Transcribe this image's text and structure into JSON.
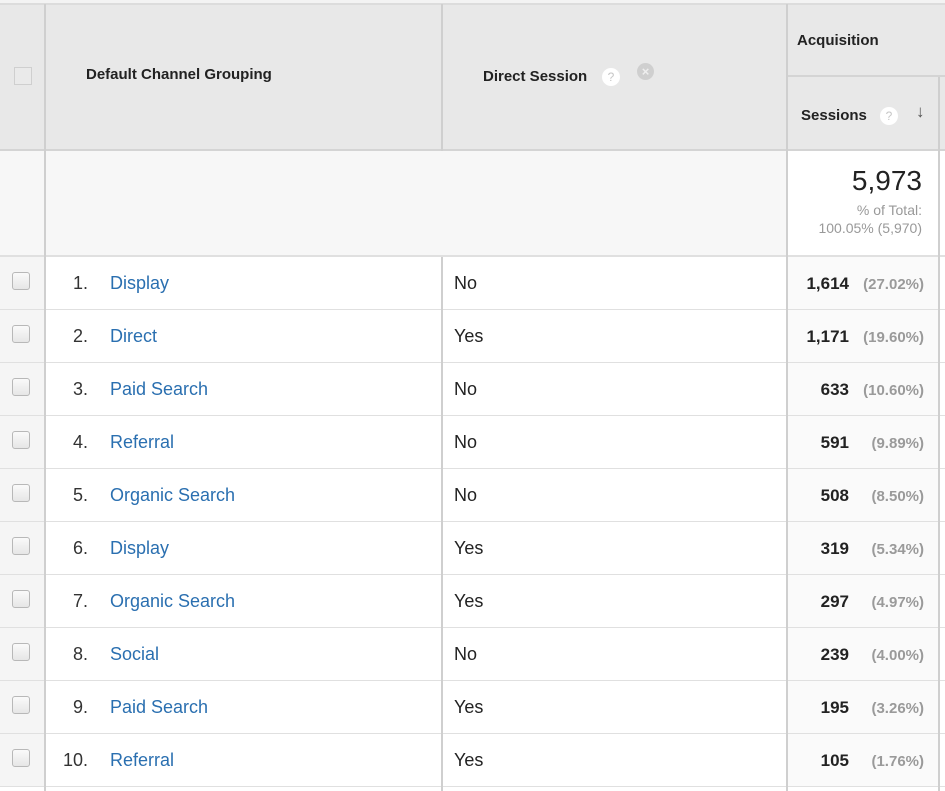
{
  "header": {
    "dimension_label": "Default Channel Grouping",
    "secondary_dimension_label": "Direct Session",
    "group_label": "Acquisition",
    "metric_label": "Sessions",
    "help_glyph": "?",
    "remove_glyph": "×",
    "sort_glyph": "↓"
  },
  "icons": {
    "help": "help-icon",
    "remove": "remove-dimension-icon",
    "sort": "sort-descending-arrow-icon",
    "checkbox": "checkbox"
  },
  "totals": {
    "sessions": "5,973",
    "pct_of_total_label": "% of Total:",
    "pct_of_total_value": "100.05% (5,970)"
  },
  "colors": {
    "link": "#2a6fb0",
    "header_bg": "#e8e8e8",
    "muted_text": "#9a9a9a"
  },
  "rows": [
    {
      "index": "1.",
      "channel": "Display",
      "direct": "No",
      "sessions": "1,614",
      "pct": "(27.02%)"
    },
    {
      "index": "2.",
      "channel": "Direct",
      "direct": "Yes",
      "sessions": "1,171",
      "pct": "(19.60%)"
    },
    {
      "index": "3.",
      "channel": "Paid Search",
      "direct": "No",
      "sessions": "633",
      "pct": "(10.60%)"
    },
    {
      "index": "4.",
      "channel": "Referral",
      "direct": "No",
      "sessions": "591",
      "pct": "(9.89%)"
    },
    {
      "index": "5.",
      "channel": "Organic Search",
      "direct": "No",
      "sessions": "508",
      "pct": "(8.50%)"
    },
    {
      "index": "6.",
      "channel": "Display",
      "direct": "Yes",
      "sessions": "319",
      "pct": "(5.34%)"
    },
    {
      "index": "7.",
      "channel": "Organic Search",
      "direct": "Yes",
      "sessions": "297",
      "pct": "(4.97%)"
    },
    {
      "index": "8.",
      "channel": "Social",
      "direct": "No",
      "sessions": "239",
      "pct": "(4.00%)"
    },
    {
      "index": "9.",
      "channel": "Paid Search",
      "direct": "Yes",
      "sessions": "195",
      "pct": "(3.26%)"
    },
    {
      "index": "10.",
      "channel": "Referral",
      "direct": "Yes",
      "sessions": "105",
      "pct": "(1.76%)"
    }
  ]
}
